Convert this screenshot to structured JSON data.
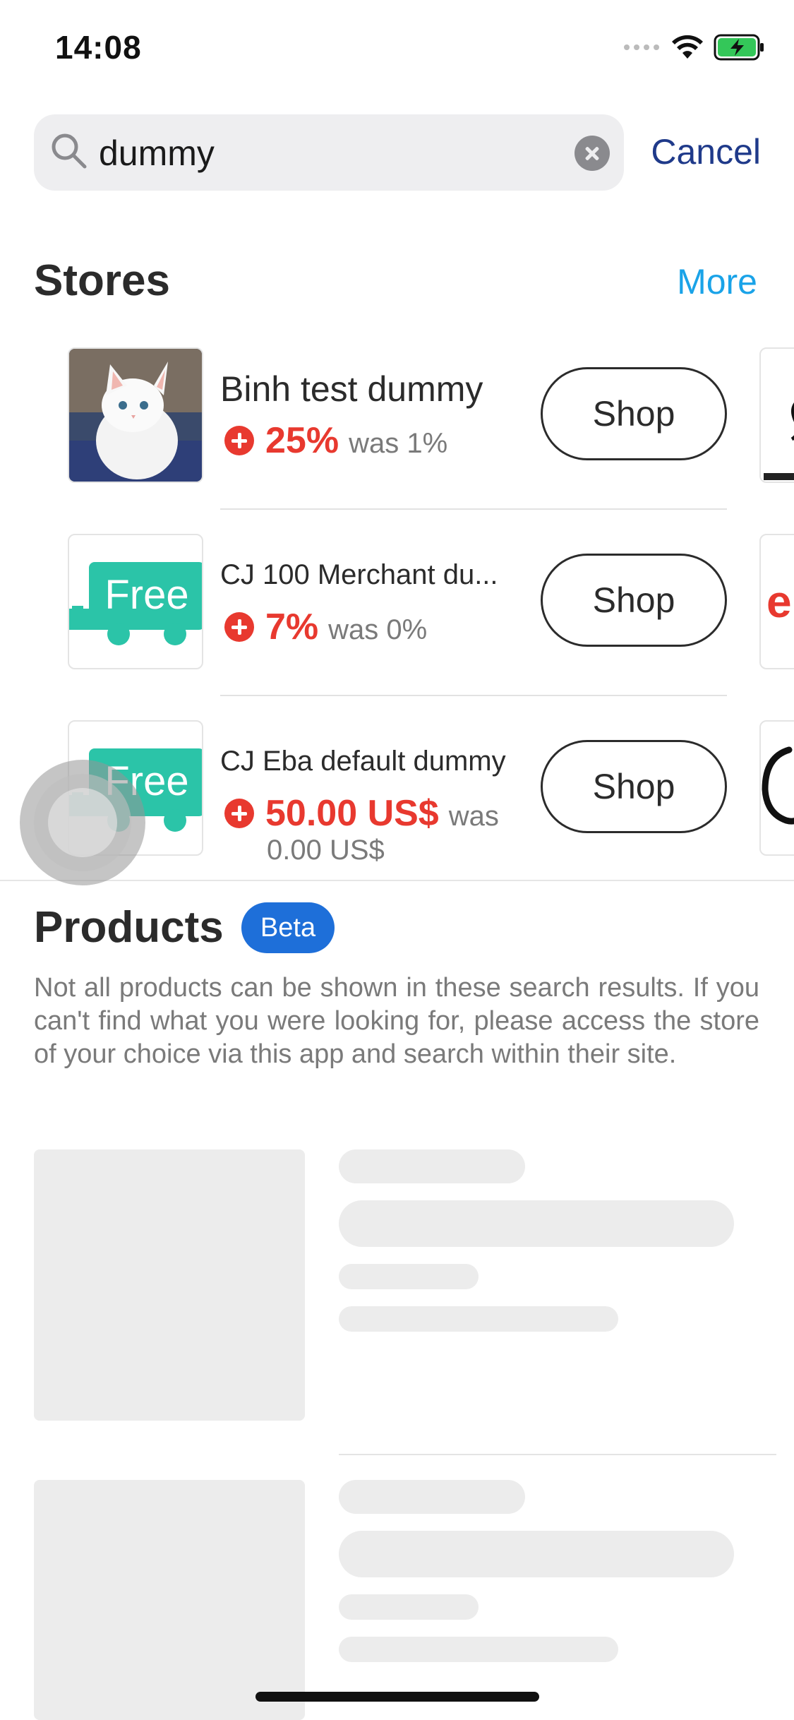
{
  "status_bar": {
    "time": "14:08"
  },
  "search": {
    "query": "dummy",
    "cancel_label": "Cancel"
  },
  "stores": {
    "title": "Stores",
    "more_label": "More",
    "items": [
      {
        "name": "Binh test dummy",
        "rate": "25%",
        "was": "was 1%",
        "shop_label": "Shop",
        "logo": "kitten-photo"
      },
      {
        "name": "CJ 100 Merchant du...",
        "rate": "7%",
        "was": "was 0%",
        "shop_label": "Shop",
        "logo": "free-truck-logo"
      },
      {
        "name": "CJ Eba default dummy",
        "rate": "50.00 US$",
        "was_line1": "was",
        "was_line2": "0.00 US$",
        "shop_label": "Shop",
        "logo": "free-truck-logo"
      }
    ]
  },
  "logo_text": {
    "free": "Free",
    "peek_2": "e"
  },
  "products": {
    "title": "Products",
    "badge": "Beta",
    "disclaimer": "Not all products can be shown in these search results. If you can't find what you were looking for, please access the store of your choice via this app and search within their site."
  },
  "colors": {
    "accent_red": "#e8392f",
    "link_blue": "#1aa3e8",
    "cancel_navy": "#1f3a8a",
    "beta_blue": "#1e6fd9",
    "truck_teal": "#2bc4a8",
    "skeleton_gray": "#ececec"
  }
}
